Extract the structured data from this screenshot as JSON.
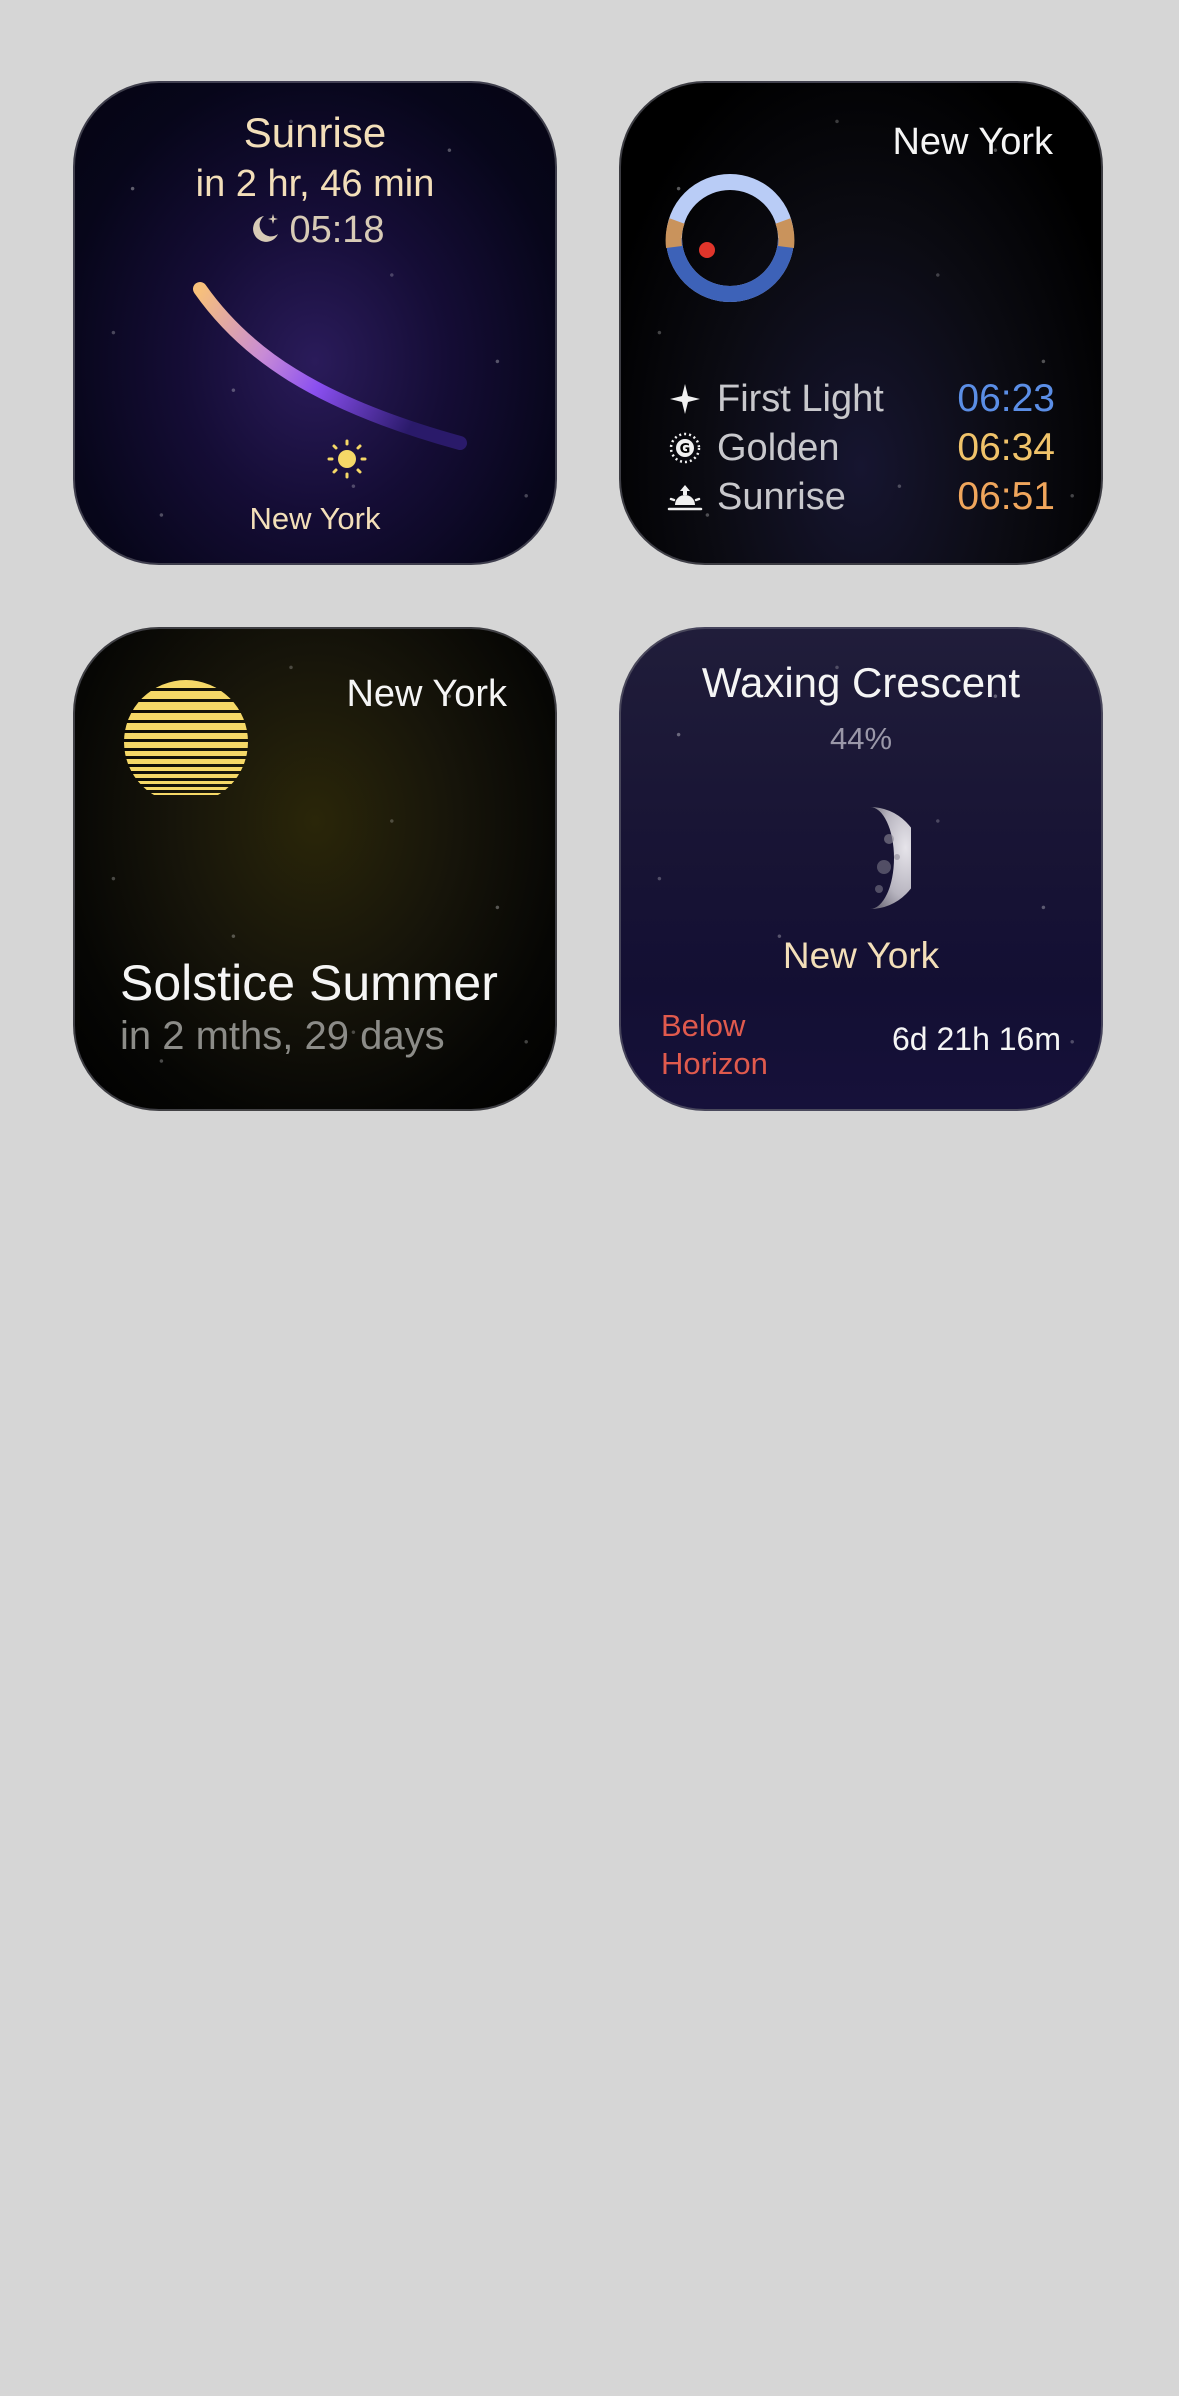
{
  "widgets": {
    "sunrise": {
      "title": "Sunrise",
      "countdown": "in 2 hr, 46 min",
      "moon_time": "05:18",
      "city": "New York",
      "icons": [
        "moon-stars-icon",
        "sun-icon"
      ]
    },
    "times": {
      "city": "New York",
      "rows": [
        {
          "icon": "sparkle-icon",
          "label": "First Light",
          "time": "06:23",
          "color": "#5b8ee6"
        },
        {
          "icon": "golden-hour-icon",
          "label": "Golden",
          "time": "06:34",
          "color": "#f0c36a"
        },
        {
          "icon": "sunrise-icon",
          "label": "Sunrise",
          "time": "06:51",
          "color": "#f0a65c"
        }
      ]
    },
    "solstice": {
      "city": "New York",
      "event": "Solstice Summer",
      "when": "in 2 mths, 29 days",
      "sun_color": "#f5d867"
    },
    "moon": {
      "phase": "Waxing Crescent",
      "illumination": "44%",
      "city": "New York",
      "status": "Below Horizon",
      "next": "6d 21h 16m",
      "status_color": "#e05a4d"
    }
  }
}
